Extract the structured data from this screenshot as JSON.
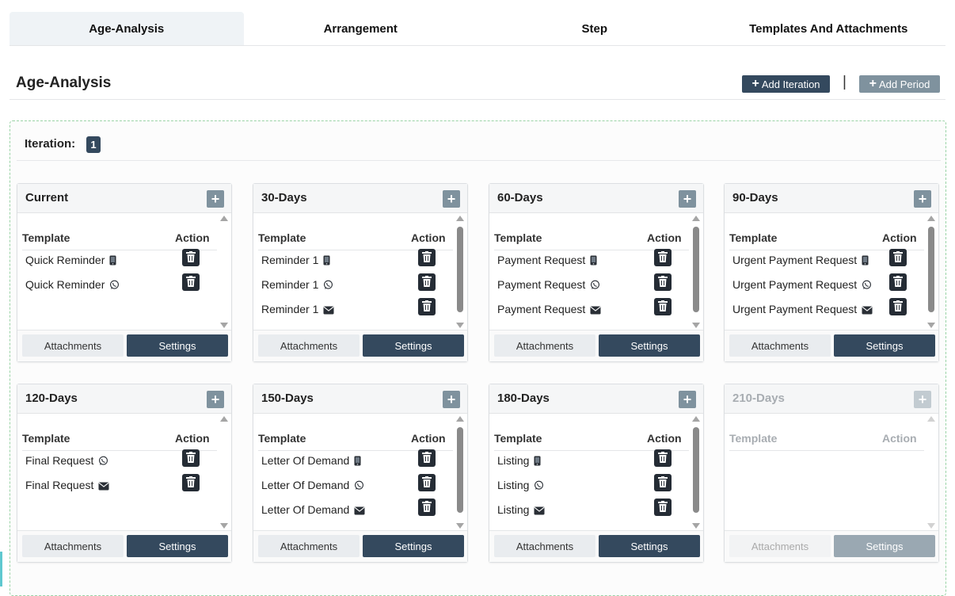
{
  "tabs": [
    {
      "label": "Age-Analysis",
      "active": true
    },
    {
      "label": "Arrangement",
      "active": false
    },
    {
      "label": "Step",
      "active": false
    },
    {
      "label": "Templates And Attachments",
      "active": false
    }
  ],
  "header": {
    "title": "Age-Analysis",
    "add_iteration_label": "Add Iteration",
    "separator": "|",
    "add_period_label": "Add Period"
  },
  "iteration": {
    "label": "Iteration:",
    "number": "1"
  },
  "table_headers": {
    "template": "Template",
    "action": "Action"
  },
  "footer": {
    "attachments_label": "Attachments",
    "settings_label": "Settings"
  },
  "periods": [
    {
      "title": "Current",
      "rows": [
        {
          "label": "Quick Reminder",
          "channel": "sms"
        },
        {
          "label": "Quick Reminder",
          "channel": "whatsapp"
        }
      ]
    },
    {
      "title": "30-Days",
      "rows": [
        {
          "label": "Reminder 1",
          "channel": "sms"
        },
        {
          "label": "Reminder 1",
          "channel": "whatsapp"
        },
        {
          "label": "Reminder 1",
          "channel": "email"
        }
      ]
    },
    {
      "title": "60-Days",
      "rows": [
        {
          "label": "Payment Request",
          "channel": "sms"
        },
        {
          "label": "Payment Request",
          "channel": "whatsapp"
        },
        {
          "label": "Payment Request",
          "channel": "email"
        }
      ]
    },
    {
      "title": "90-Days",
      "rows": [
        {
          "label": "Urgent Payment Request",
          "channel": "sms"
        },
        {
          "label": "Urgent Payment Request",
          "channel": "whatsapp"
        },
        {
          "label": "Urgent Payment Request",
          "channel": "email"
        }
      ]
    },
    {
      "title": "120-Days",
      "rows": [
        {
          "label": "Final Request",
          "channel": "whatsapp"
        },
        {
          "label": "Final Request",
          "channel": "email"
        }
      ]
    },
    {
      "title": "150-Days",
      "rows": [
        {
          "label": "Letter Of Demand",
          "channel": "sms"
        },
        {
          "label": "Letter Of Demand",
          "channel": "whatsapp"
        },
        {
          "label": "Letter Of Demand",
          "channel": "email"
        }
      ]
    },
    {
      "title": "180-Days",
      "rows": [
        {
          "label": "Listing",
          "channel": "sms"
        },
        {
          "label": "Listing",
          "channel": "whatsapp"
        },
        {
          "label": "Listing",
          "channel": "email"
        }
      ]
    },
    {
      "title": "210-Days",
      "disabled": true,
      "rows": []
    }
  ],
  "colors": {
    "primary": "#34495e",
    "secondary": "#7f929e",
    "panel_border": "#9ad3a6"
  }
}
